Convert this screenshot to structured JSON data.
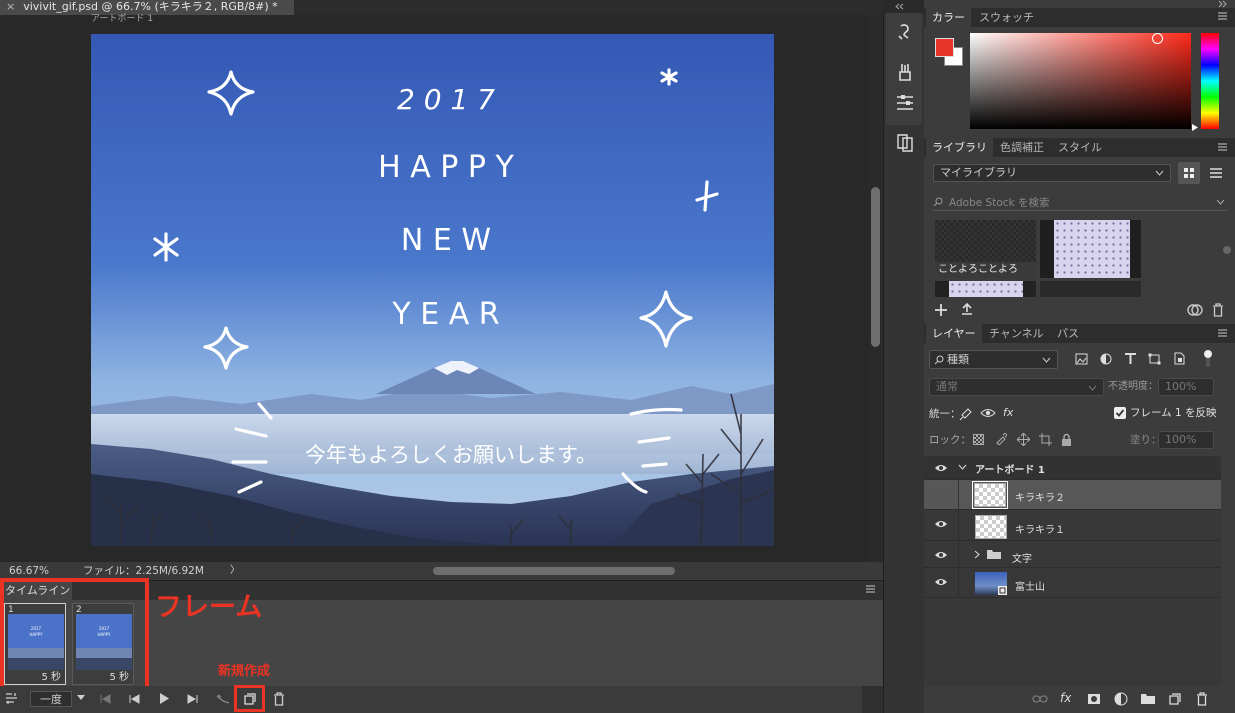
{
  "document": {
    "close_glyph": "×",
    "tab_title": "vivivit_gif.psd @ 66.7% (キラキラ２, RGB/8#) *",
    "artboard_label": "アートボード 1"
  },
  "artwork": {
    "year": "2 0 1 7",
    "line1": "H A P P Y",
    "line2": "N E W",
    "line3": "Y E A R",
    "message": "今年もよろしくお願いします。"
  },
  "status": {
    "zoom": "66.67%",
    "file_info": "ファイル：2.25M/6.92M",
    "arrow": "〉"
  },
  "timeline": {
    "tab_label": "タイムライン",
    "frames": [
      {
        "number": "1",
        "duration": "5 秒"
      },
      {
        "number": "2",
        "duration": "5 秒"
      }
    ],
    "loop": "一度"
  },
  "annotations": {
    "frames_label": "フレーム",
    "new_label": "新規作成",
    "color": "#ea3323"
  },
  "color_panel": {
    "tabs": [
      "カラー",
      "スウォッチ"
    ],
    "foreground": "#e8372a",
    "background": "#ffffff"
  },
  "library_panel": {
    "tabs": [
      "ライブラリ",
      "色調補正",
      "スタイル"
    ],
    "library_select": "マイライブラリ",
    "search_placeholder": "Adobe Stock を検索",
    "item_caption": "ことよろことよろ"
  },
  "layers_panel": {
    "tabs": [
      "レイヤー",
      "チャンネル",
      "パス"
    ],
    "filter_select": "種類",
    "blend_mode": "通常",
    "opacity_label": "不透明度：",
    "opacity_value": "100%",
    "unify_label": "統一：",
    "propagate_label": "フレーム 1 を反映",
    "lock_label": "ロック：",
    "fill_label": "塗り：",
    "fill_value": "100%",
    "artboard_group": "アートボード 1",
    "layers": [
      {
        "name": "キラキラ２",
        "visible": false,
        "selected": true
      },
      {
        "name": "キラキラ１",
        "visible": true,
        "selected": false
      },
      {
        "name": "文字",
        "visible": true,
        "selected": false
      },
      {
        "name": "富士山",
        "visible": true,
        "selected": false
      }
    ]
  }
}
